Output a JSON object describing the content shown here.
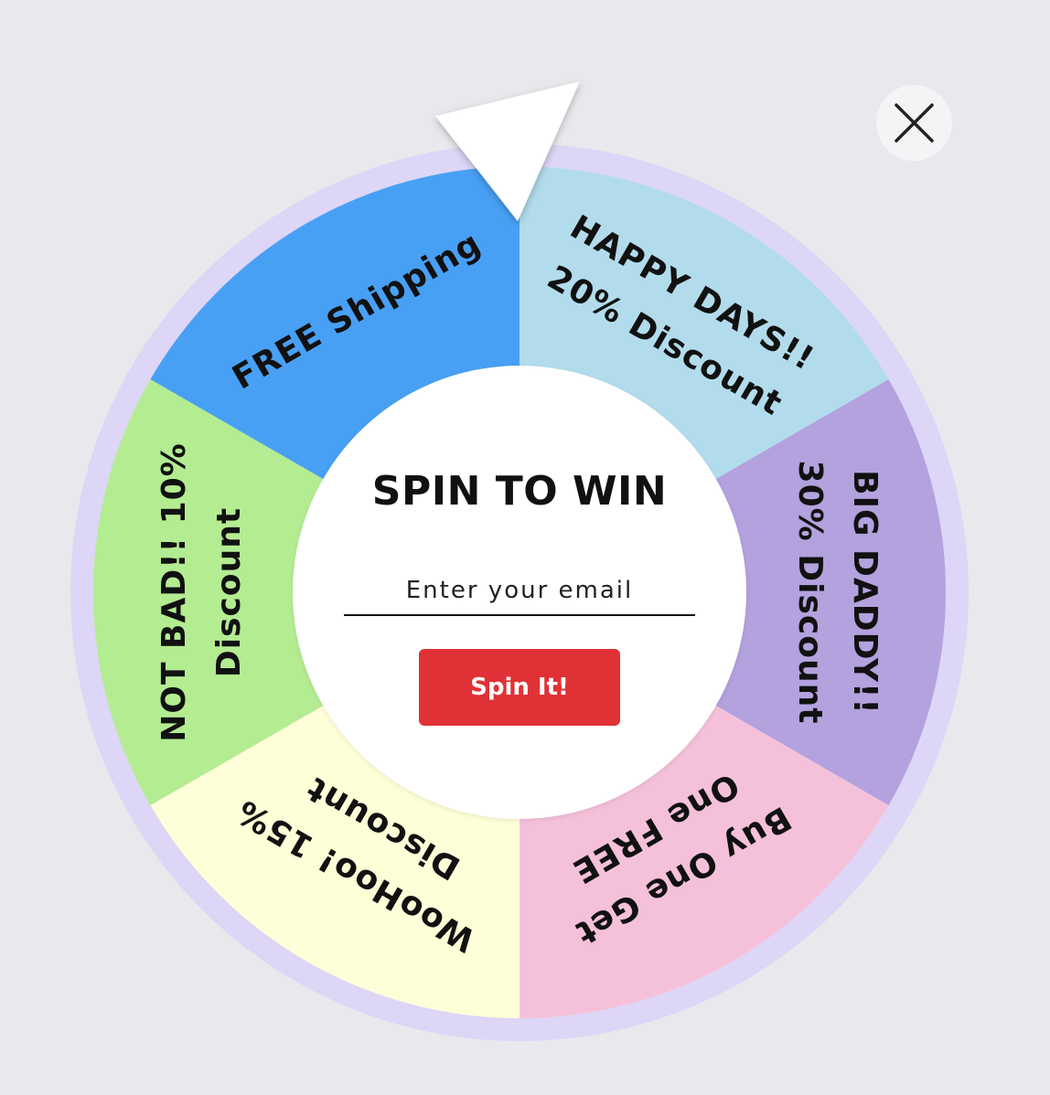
{
  "wheel": {
    "segments": [
      {
        "lines": [
          "HAPPY DAYS!!",
          "20% Discount"
        ],
        "color": "#b2dcec"
      },
      {
        "lines": [
          "BIG DADDY!!",
          "30% Discount"
        ],
        "color": "#b3a2de"
      },
      {
        "lines": [
          "Buy One Get",
          "One FREE"
        ],
        "color": "#f5c1da"
      },
      {
        "lines": [
          "WooHoo! 15%",
          "Discount"
        ],
        "color": "#fefed8"
      },
      {
        "lines": [
          "NOT BAD!! 10%",
          "Discount"
        ],
        "color": "#b4ec92"
      },
      {
        "lines": [
          "FREE Shipping"
        ],
        "color": "#48a0f4"
      }
    ],
    "rim_color": "#ddd6f6",
    "pointer_color": "#ffffff"
  },
  "center": {
    "title": "SPIN TO WIN",
    "email_placeholder": "Enter your email",
    "button_label": "Spin It!",
    "button_color": "#e03236"
  },
  "close": {
    "icon": "close-icon"
  }
}
